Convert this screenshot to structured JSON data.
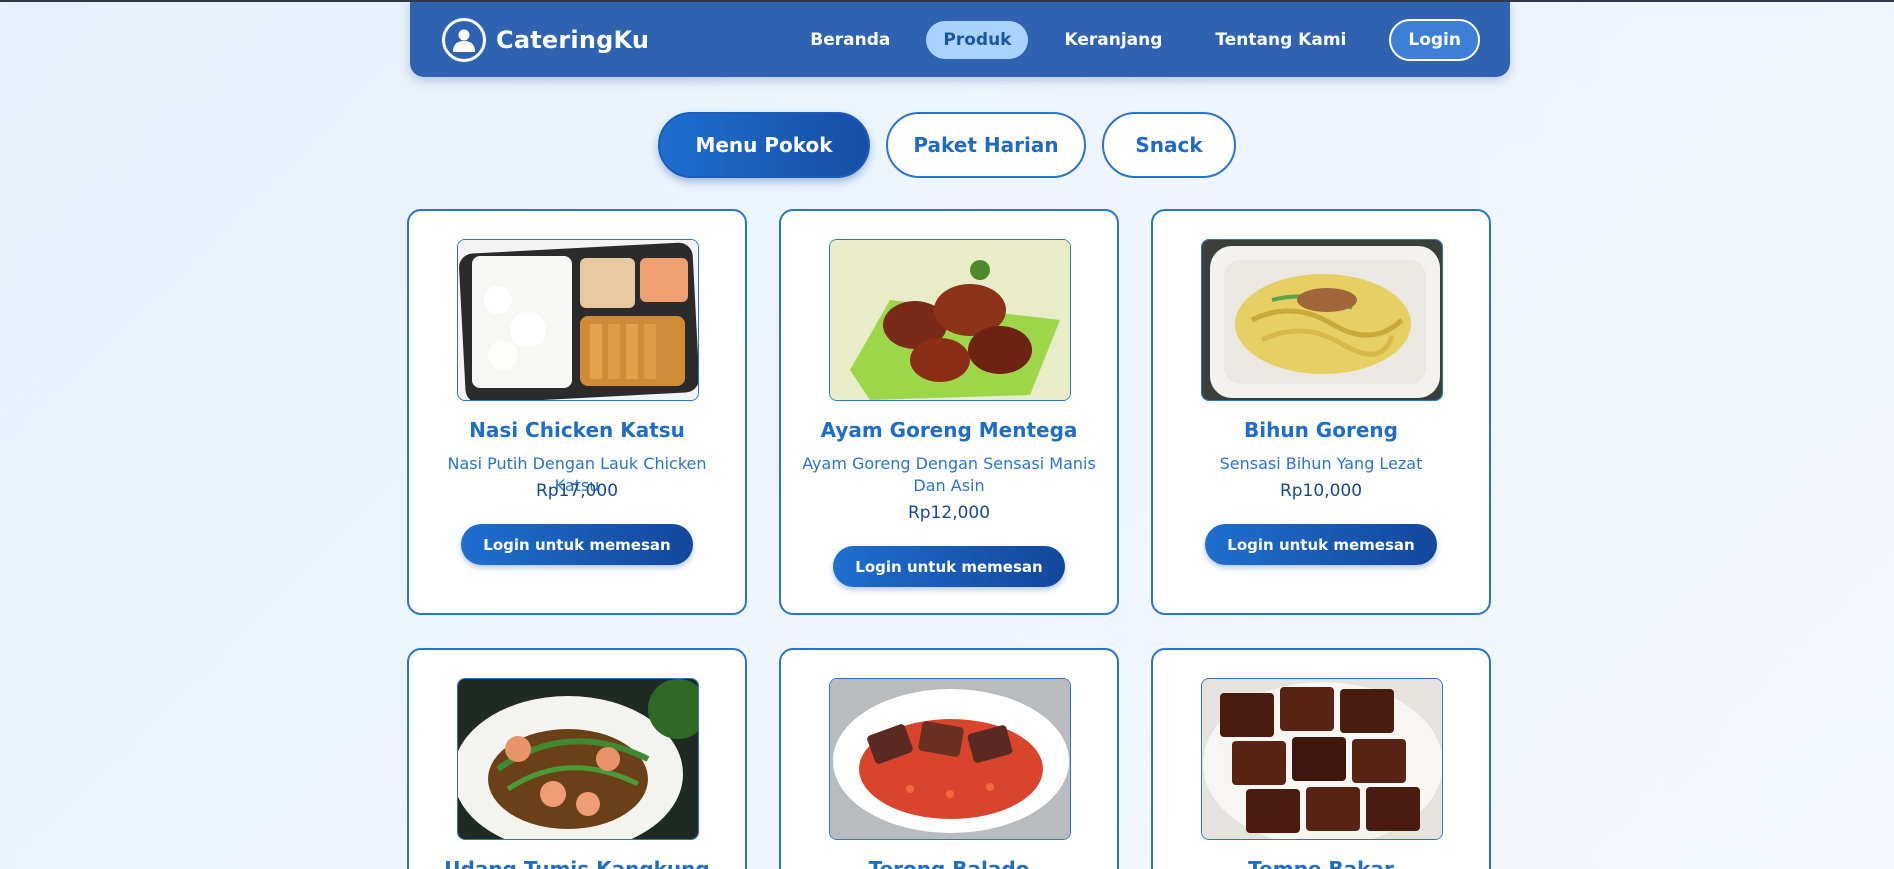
{
  "brand": {
    "name": "CateringKu"
  },
  "nav": {
    "items": [
      "Beranda",
      "Produk",
      "Keranjang",
      "Tentang Kami"
    ],
    "active": "Produk",
    "login": "Login"
  },
  "tabs": [
    {
      "label": "Menu Pokok",
      "active": true
    },
    {
      "label": "Paket Harian",
      "active": false
    },
    {
      "label": "Snack",
      "active": false
    }
  ],
  "products": [
    {
      "name": "Nasi Chicken Katsu",
      "description": "Nasi Putih Dengan Lauk Chicken Katsu",
      "price": "Rp17,000",
      "button": "Login untuk memesan",
      "image": "chicken-katsu-bento"
    },
    {
      "name": "Ayam Goreng Mentega",
      "description": "Ayam Goreng Dengan Sensasi Manis Dan Asin",
      "price": "Rp12,000",
      "button": "Login untuk memesan",
      "image": "butter-fried-chicken"
    },
    {
      "name": "Bihun Goreng",
      "description": "Sensasi Bihun Yang Lezat",
      "price": "Rp10,000",
      "button": "Login untuk memesan",
      "image": "fried-vermicelli"
    },
    {
      "name": "Udang Tumis Kangkung",
      "description": "",
      "price": "",
      "button": "",
      "image": "shrimp-water-spinach"
    },
    {
      "name": "Terong Balado",
      "description": "",
      "price": "",
      "button": "",
      "image": "eggplant-balado"
    },
    {
      "name": "Tempe Bakar",
      "description": "",
      "price": "",
      "button": "",
      "image": "grilled-tempeh"
    }
  ],
  "colors": {
    "primary": "#2f62b0",
    "accent": "#2a74cc",
    "active_nav": "#a9d2ff"
  }
}
